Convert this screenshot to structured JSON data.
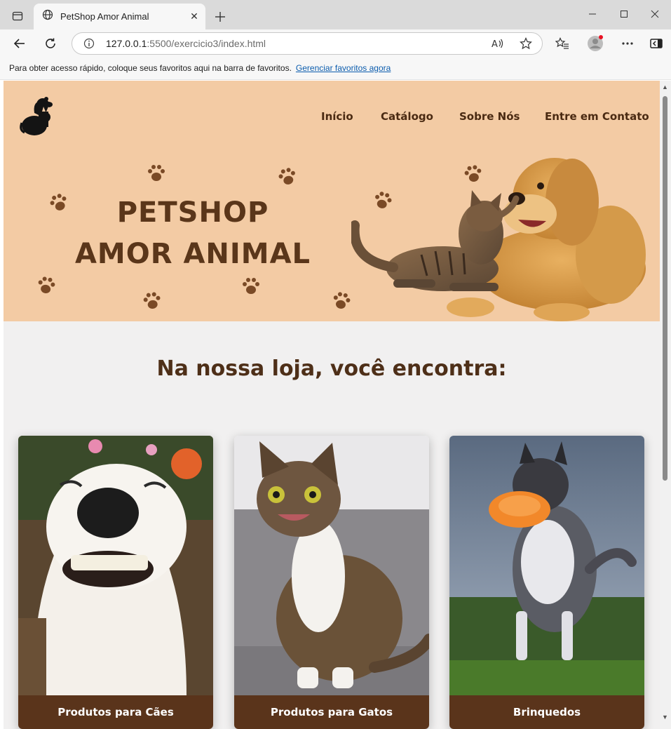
{
  "browser": {
    "tab_title": "PetShop Amor Animal",
    "url_host": "127.0.0.1",
    "url_rest": ":5500/exercicio3/index.html",
    "favorites_message": "Para obter acesso rápido, coloque seus favoritos aqui na barra de favoritos.",
    "favorites_link": "Gerenciar favoritos agora"
  },
  "site": {
    "nav": [
      "Início",
      "Catálogo",
      "Sobre Nós",
      "Entre em Contato"
    ],
    "hero_title_line1": "PETSHOP",
    "hero_title_line2": "AMOR ANIMAL",
    "section_title": "Na nossa loja, você encontra:",
    "cards": [
      {
        "label": "Produtos para Cães"
      },
      {
        "label": "Produtos para Gatos"
      },
      {
        "label": "Brinquedos"
      }
    ]
  },
  "colors": {
    "hero_bg": "#f3cba4",
    "brown_dark": "#5a341b",
    "page_bg": "#f1f0f0"
  },
  "icons": {
    "tab_actions": "tab-actions-icon",
    "globe": "globe-icon",
    "close": "close-icon",
    "new_tab": "plus-icon",
    "back": "back-arrow-icon",
    "refresh": "refresh-icon",
    "info": "info-icon",
    "read_aloud": "read-aloud-icon",
    "favorite": "star-icon",
    "favorites_list": "favorites-list-icon",
    "profile": "profile-avatar-icon",
    "more": "more-icon",
    "sidebar": "sidebar-icon"
  }
}
